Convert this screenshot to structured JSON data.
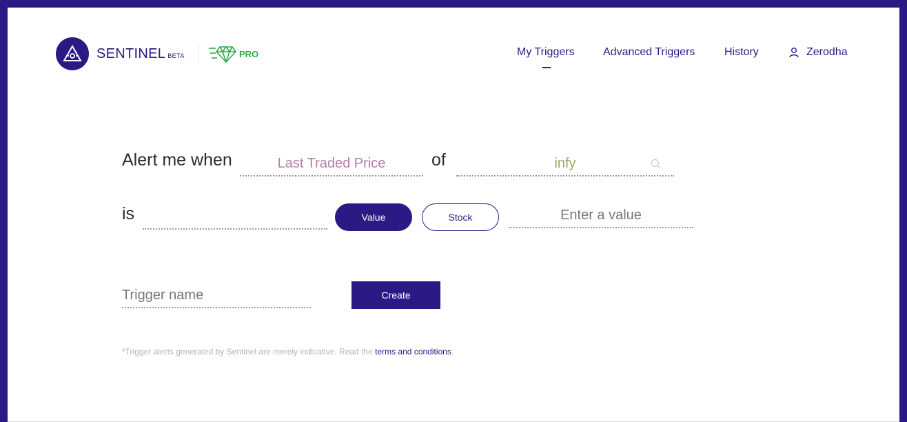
{
  "brand": {
    "name": "SENTINEL",
    "beta_label": "BETA",
    "pro_label": "PRO",
    "primary_color": "#2a1a84",
    "pro_color": "#2ea84a"
  },
  "nav": {
    "items": [
      {
        "label": "My Triggers",
        "active": true
      },
      {
        "label": "Advanced Triggers"
      },
      {
        "label": "History"
      }
    ],
    "user": {
      "label": "Zerodha",
      "icon": "user-icon"
    }
  },
  "form": {
    "prefix_label": "Alert me when",
    "attribute": {
      "value": "Last Traded Price",
      "color": "#b47ca8"
    },
    "of_label": "of",
    "stock": {
      "value": "infy",
      "color": "#9aab62",
      "icon": "search-icon"
    },
    "is_label": "is",
    "operator": {
      "value": ""
    },
    "mode_toggle": {
      "options": [
        "Value",
        "Stock"
      ],
      "selected": "Value"
    },
    "target_value": {
      "placeholder": "Enter a value"
    },
    "trigger_name": {
      "placeholder": "Trigger name"
    },
    "create_label": "Create"
  },
  "footnote": {
    "text": "*Trigger alerts generated by Sentinel are merely indicative. Read the ",
    "link_text": "terms and conditions",
    "end": "."
  }
}
